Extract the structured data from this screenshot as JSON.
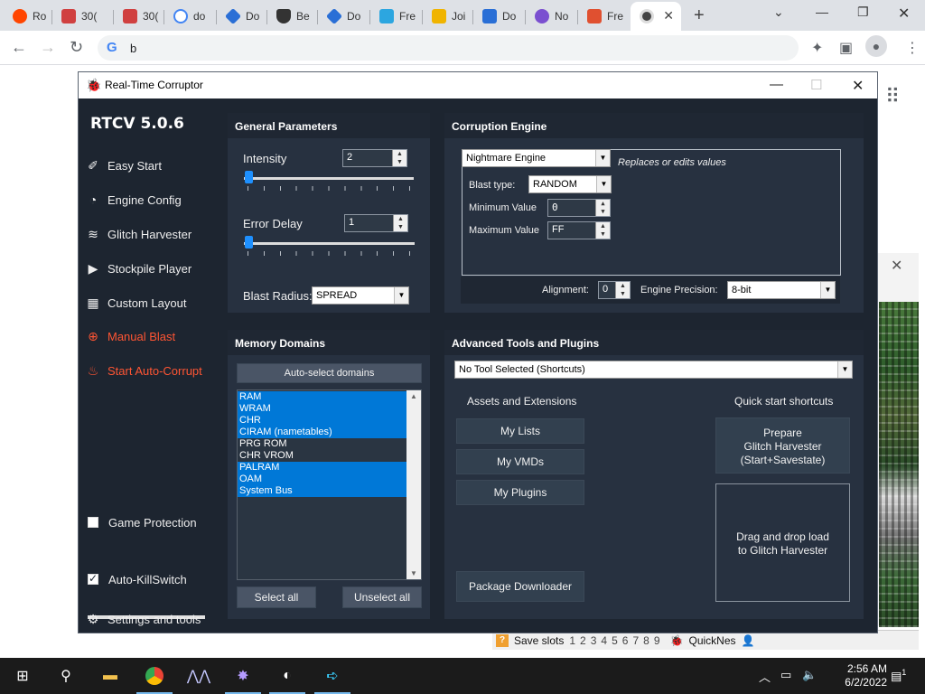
{
  "browser": {
    "tabs": [
      {
        "label": "Ro",
        "color": "#ff4500"
      },
      {
        "label": "30(",
        "color": "#d04040"
      },
      {
        "label": "30(",
        "color": "#d04040"
      },
      {
        "label": "do",
        "color": "#4285f4"
      },
      {
        "label": "Do",
        "color": "#2a6fd6"
      },
      {
        "label": "Be",
        "color": "#333333"
      },
      {
        "label": "Do",
        "color": "#2a6fd6"
      },
      {
        "label": "Fre",
        "color": "#2ca6e0"
      },
      {
        "label": "Joi",
        "color": "#f0b400"
      },
      {
        "label": "Do",
        "color": "#2a6fd6"
      },
      {
        "label": "No",
        "color": "#7a4fd0"
      },
      {
        "label": "Fre",
        "color": "#e05030"
      }
    ],
    "address_text": "b"
  },
  "rtc": {
    "window_title": "Real-Time Corruptor",
    "brand": "RTCV 5.0.6",
    "nav": [
      {
        "label": "Easy Start",
        "icon": "wand-icon"
      },
      {
        "label": "Engine Config",
        "icon": "gauge-icon"
      },
      {
        "label": "Glitch Harvester",
        "icon": "layers-icon"
      },
      {
        "label": "Stockpile Player",
        "icon": "play-icon"
      },
      {
        "label": "Custom Layout",
        "icon": "grid-icon"
      },
      {
        "label": "Manual Blast",
        "icon": "crosshair-icon"
      },
      {
        "label": "Start Auto-Corrupt",
        "icon": "flame-icon"
      }
    ],
    "game_protection": "Game Protection",
    "auto_killswitch": "Auto-KillSwitch",
    "settings": "Settings and tools",
    "general": {
      "title": "General Parameters",
      "intensity_label": "Intensity",
      "intensity_value": "2",
      "error_delay_label": "Error Delay",
      "error_delay_value": "1",
      "blast_radius_label": "Blast Radius:",
      "blast_radius_value": "SPREAD"
    },
    "engine": {
      "title": "Corruption Engine",
      "engine_value": "Nightmare Engine",
      "engine_desc": "Replaces or edits values",
      "blast_type_label": "Blast type:",
      "blast_type_value": "RANDOM",
      "min_label": "Minimum Value",
      "min_value": "0",
      "max_label": "Maximum Value",
      "max_value": "FF",
      "alignment_label": "Alignment:",
      "alignment_value": "0",
      "precision_label": "Engine Precision:",
      "precision_value": "8-bit"
    },
    "memory": {
      "title": "Memory Domains",
      "auto_select": "Auto-select domains",
      "domains": [
        {
          "label": "RAM",
          "selected": true
        },
        {
          "label": "WRAM",
          "selected": true
        },
        {
          "label": "CHR",
          "selected": true
        },
        {
          "label": "CIRAM (nametables)",
          "selected": true
        },
        {
          "label": "PRG ROM",
          "selected": false
        },
        {
          "label": "CHR VROM",
          "selected": false
        },
        {
          "label": "PALRAM",
          "selected": true
        },
        {
          "label": "OAM",
          "selected": true
        },
        {
          "label": "System Bus",
          "selected": true
        }
      ],
      "select_all": "Select all",
      "unselect_all": "Unselect all"
    },
    "tools": {
      "title": "Advanced Tools and Plugins",
      "tool_select": "No Tool Selected (Shortcuts)",
      "assets_title": "Assets and Extensions",
      "my_lists": "My Lists",
      "my_vmds": "My VMDs",
      "my_plugins": "My Plugins",
      "package_downloader": "Package Downloader",
      "quick_title": "Quick start shortcuts",
      "prepare_line1": "Prepare",
      "prepare_line2": "Glitch Harvester",
      "prepare_line3": "(Start+Savestate)",
      "drop_line1": "Drag and drop load",
      "drop_line2": "to Glitch Harvester"
    }
  },
  "emulator": {
    "save_slots_label": "Save slots",
    "slots": [
      "1",
      "2",
      "3",
      "4",
      "5",
      "6",
      "7",
      "8",
      "9"
    ],
    "core": "QuickNes"
  },
  "taskbar": {
    "time": "2:56 AM",
    "date": "6/2/2022",
    "notifications": "1"
  }
}
